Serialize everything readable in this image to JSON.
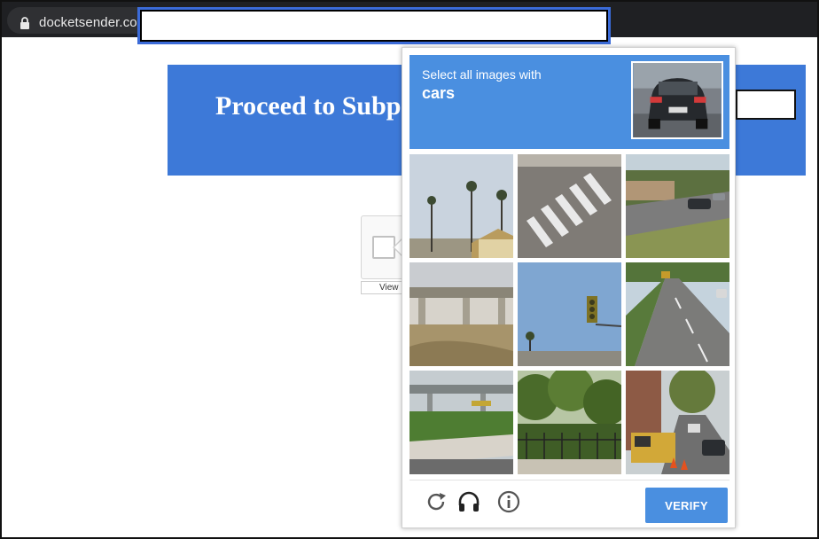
{
  "browser": {
    "url": "docketsender.com/",
    "lock_icon": "lock-icon"
  },
  "page": {
    "banner_title": "Proceed to Subpo",
    "banner_color": "#3d79d8"
  },
  "checkbox_widget": {
    "view_label": "View"
  },
  "captcha": {
    "instruction": "Select all images with",
    "target": "cars",
    "header_color": "#4a8fe0",
    "verify_label": "VERIFY",
    "tiles": [
      {
        "scene": "palm trees and house roof"
      },
      {
        "scene": "crosswalk on street"
      },
      {
        "scene": "road with cars"
      },
      {
        "scene": "freeway overpass bridge"
      },
      {
        "scene": "traffic light"
      },
      {
        "scene": "highway with vehicles"
      },
      {
        "scene": "elevated bridge and grass"
      },
      {
        "scene": "trees behind fence"
      },
      {
        "scene": "city street with truck and cars"
      }
    ],
    "footer_icons": [
      "reload-icon",
      "audio-headphones-icon",
      "info-icon"
    ]
  }
}
